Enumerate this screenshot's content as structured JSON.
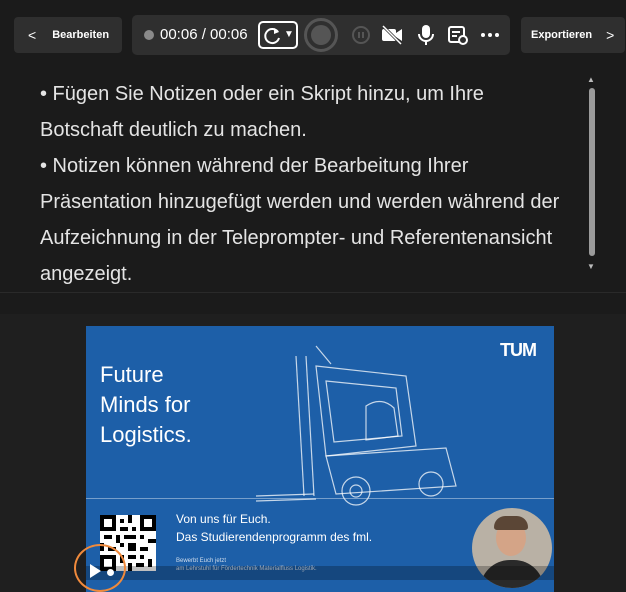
{
  "toolbar": {
    "back_label": "Bearbeiten",
    "timer": "00:06 / 00:06",
    "export_label": "Exportieren",
    "icons": [
      "chevron-left-icon",
      "retake-icon",
      "record-icon",
      "pause-icon",
      "camera-off-icon",
      "microphone-icon",
      "notes-settings-icon",
      "more-icon",
      "chevron-right-icon"
    ]
  },
  "notes": {
    "lines": [
      "• Fügen Sie Notizen oder ein Skript hinzu, um Ihre",
      "Botschaft deutlich zu machen.",
      "• Notizen können während der Bearbeitung Ihrer",
      "Präsentation hinzugefügt werden und werden während der",
      "Aufzeichnung in der Teleprompter- und Referentenansicht",
      "angezeigt."
    ]
  },
  "slide": {
    "title_lines": [
      "Future",
      "Minds for",
      "Logistics."
    ],
    "logo": "TUM",
    "subtitle1": "Von uns für Euch.",
    "subtitle2": "Das Studierendenprogramm des fml.",
    "tiny1": "Bewerbt Euch jetzt",
    "tiny2": "am Lehrstuhl für Fördertechnik Materialfluss Logistik.",
    "colors": {
      "background": "#1d5fa8",
      "play_ring": "#f08a3c"
    }
  }
}
